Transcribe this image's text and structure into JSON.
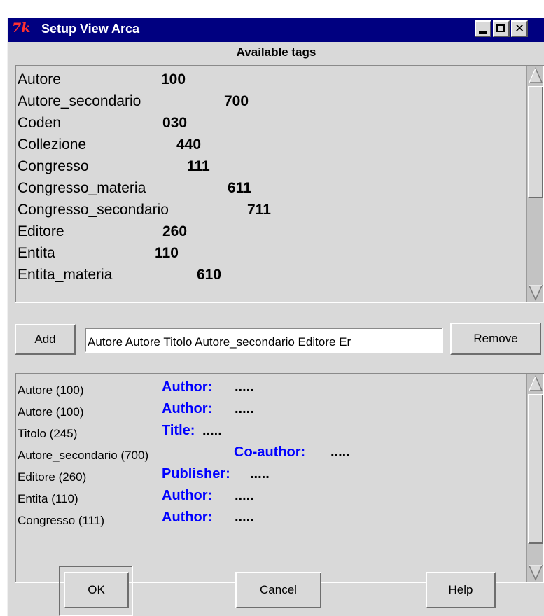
{
  "window": {
    "title": "Setup View Arca",
    "logo_glyph": "7k",
    "title_icon": "tk-feather-icon",
    "accent_color": "#000080"
  },
  "available_tags": {
    "heading": "Available tags",
    "items": [
      {
        "name": "Autore",
        "code": "100"
      },
      {
        "name": "Autore_secondario",
        "code": "700"
      },
      {
        "name": "Coden",
        "code": "030"
      },
      {
        "name": "Collezione",
        "code": "440"
      },
      {
        "name": "Congresso",
        "code": "111"
      },
      {
        "name": "Congresso_materia",
        "code": "611"
      },
      {
        "name": "Congresso_secondario",
        "code": "711"
      },
      {
        "name": "Editore",
        "code": "260"
      },
      {
        "name": "Entita",
        "code": "110"
      },
      {
        "name": "Entita_materia",
        "code": "610"
      }
    ]
  },
  "controls": {
    "add_label": "Add",
    "entry_value": "Autore Autore Titolo Autore_secondario Editore Er",
    "remove_label": "Remove"
  },
  "selected": {
    "link_color": "#0000ff",
    "rows": [
      {
        "label": "Autore (100)",
        "value": "Author:",
        "dots": "....."
      },
      {
        "label": "Autore (100)",
        "value": "Author:",
        "dots": "....."
      },
      {
        "label": "Titolo (245)",
        "value": "Title:",
        "dots": "....."
      },
      {
        "label": "Autore_secondario (700)",
        "value": "Co-author:",
        "dots": "....."
      },
      {
        "label": "Editore (260)",
        "value": "Publisher:",
        "dots": "....."
      },
      {
        "label": "Entita (110)",
        "value": "Author:",
        "dots": "....."
      },
      {
        "label": "Congresso (111)",
        "value": "Author:",
        "dots": "....."
      }
    ]
  },
  "buttons": {
    "ok": "OK",
    "cancel": "Cancel",
    "help": "Help"
  }
}
